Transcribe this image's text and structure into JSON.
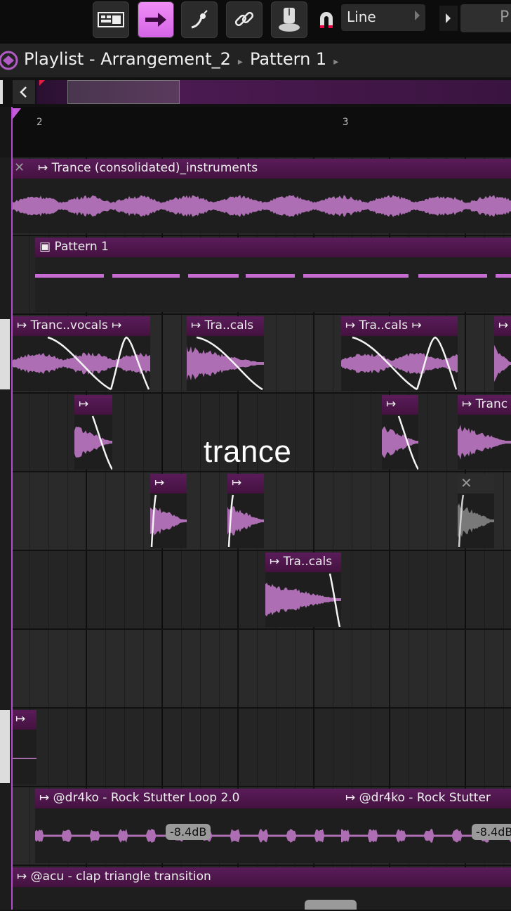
{
  "toolbar": {
    "buttons": [
      {
        "name": "playlist-view-icon"
      },
      {
        "name": "arrow-right-icon"
      },
      {
        "name": "step-edit-icon"
      },
      {
        "name": "link-icon"
      },
      {
        "name": "knob-icon"
      },
      {
        "name": "magnet-icon"
      }
    ],
    "snap_value": "Line",
    "pattern_selector_label": "P"
  },
  "title": {
    "window": "Playlist - Arrangement_2",
    "pattern": "Pattern 1"
  },
  "ruler": {
    "bars": [
      "2",
      "3"
    ]
  },
  "tracks": {
    "t1": {
      "clip1": "Trance (consolidated)_instruments"
    },
    "t2": {
      "clip1": "Pattern 1"
    },
    "t3": {
      "clip1": "Tranc..vocals",
      "clip2": "Tra..cals",
      "clip3": "Tra..cals"
    },
    "t4": {
      "clip3": "Tranc"
    },
    "t6": {
      "clip1": "Tra..cals"
    },
    "t9": {
      "clip1": "@dr4ko - Rock Stutter Loop 2.0",
      "clip2": "@dr4ko - Rock Stutter",
      "vol1": "-8.4dB",
      "vol2": "-8.4dB"
    },
    "t10": {
      "clip1": "@acu - clap triangle transition"
    }
  },
  "overlay_caption": "trance",
  "colors": {
    "accent": "#d463e6",
    "clip_header": "#4f1a4d",
    "waveform": "#c77ccf"
  }
}
